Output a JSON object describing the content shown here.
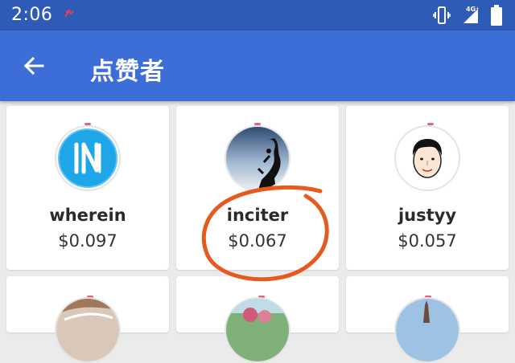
{
  "status_bar": {
    "time": "2:06",
    "network_label": "4G⁺"
  },
  "app_bar": {
    "title": "点赞者",
    "back_icon": "arrow-left-icon"
  },
  "voters": [
    {
      "username": "wherein",
      "amount": "$0.097",
      "avatar": "blue-in-logo"
    },
    {
      "username": "inciter",
      "amount": "$0.067",
      "avatar": "climber-silhouette",
      "highlighted": true
    },
    {
      "username": "justyy",
      "amount": "$0.057",
      "avatar": "cartoon-face"
    },
    {
      "username": "",
      "amount": "",
      "avatar": "photo-partial"
    },
    {
      "username": "",
      "amount": "",
      "avatar": "photo-partial"
    },
    {
      "username": "",
      "amount": "",
      "avatar": "photo-partial"
    }
  ],
  "colors": {
    "status_bar": "#2f5bb8",
    "app_bar": "#3d6ed8",
    "background": "#ebebeb",
    "card": "#ffffff",
    "accent_ring": "#e0637f",
    "annotation": "#e65a1e"
  }
}
